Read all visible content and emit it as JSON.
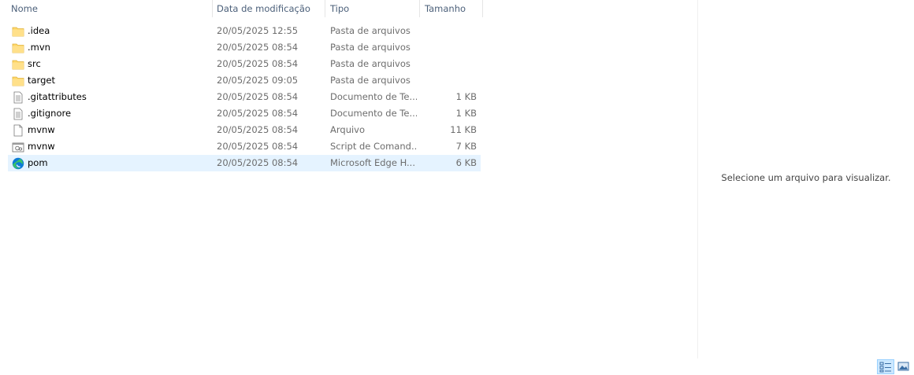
{
  "columns": {
    "name": "Nome",
    "date": "Data de modificação",
    "type": "Tipo",
    "size": "Tamanho"
  },
  "sort_indicator": "^",
  "files": [
    {
      "name": ".idea",
      "date": "20/05/2025 12:55",
      "type": "Pasta de arquivos",
      "size": "",
      "icon": "folder-icon",
      "selected": false
    },
    {
      "name": ".mvn",
      "date": "20/05/2025 08:54",
      "type": "Pasta de arquivos",
      "size": "",
      "icon": "folder-icon",
      "selected": false
    },
    {
      "name": "src",
      "date": "20/05/2025 08:54",
      "type": "Pasta de arquivos",
      "size": "",
      "icon": "folder-icon",
      "selected": false
    },
    {
      "name": "target",
      "date": "20/05/2025 09:05",
      "type": "Pasta de arquivos",
      "size": "",
      "icon": "folder-icon",
      "selected": false
    },
    {
      "name": ".gitattributes",
      "date": "20/05/2025 08:54",
      "type": "Documento de Te...",
      "size": "1 KB",
      "icon": "text-document-icon",
      "selected": false
    },
    {
      "name": ".gitignore",
      "date": "20/05/2025 08:54",
      "type": "Documento de Te...",
      "size": "1 KB",
      "icon": "text-document-icon",
      "selected": false
    },
    {
      "name": "mvnw",
      "date": "20/05/2025 08:54",
      "type": "Arquivo",
      "size": "11 KB",
      "icon": "blank-file-icon",
      "selected": false
    },
    {
      "name": "mvnw",
      "date": "20/05/2025 08:54",
      "type": "Script de Comand...",
      "size": "7 KB",
      "icon": "command-script-icon",
      "selected": false
    },
    {
      "name": "pom",
      "date": "20/05/2025 08:54",
      "type": "Microsoft Edge H...",
      "size": "6 KB",
      "icon": "edge-icon",
      "selected": true
    }
  ],
  "preview": {
    "message": "Selecione um arquivo para visualizar."
  },
  "view_buttons": {
    "details": "details-view-icon",
    "thumbnails": "large-icons-view-icon"
  },
  "colors": {
    "selected_row": "#e5f3ff",
    "header_text": "#4c607a",
    "folder": "#ffd768",
    "edge_blue": "#0c7bd6",
    "edge_green": "#3cc466"
  }
}
